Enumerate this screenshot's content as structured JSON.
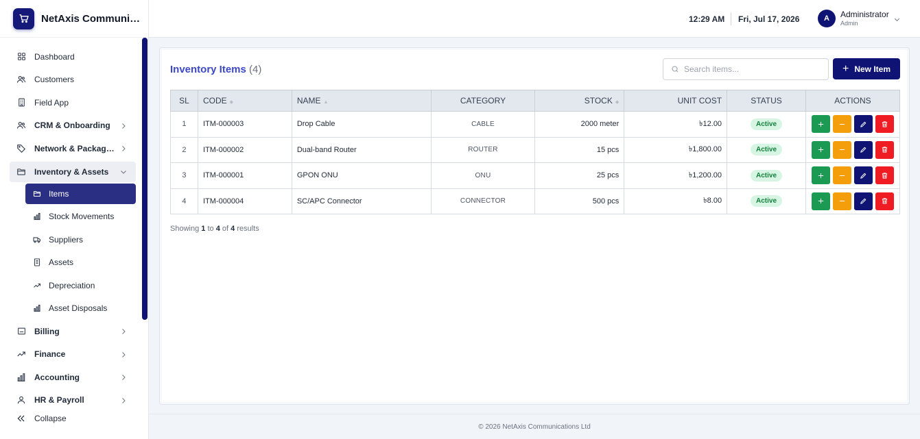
{
  "brand": {
    "name": "NetAxis Communi…"
  },
  "sidebar": {
    "items": [
      {
        "label": "Dashboard"
      },
      {
        "label": "Customers"
      },
      {
        "label": "Field App"
      },
      {
        "label": "CRM & Onboarding"
      },
      {
        "label": "Network & Packag…"
      },
      {
        "label": "Inventory & Assets"
      },
      {
        "label": "Billing"
      },
      {
        "label": "Finance"
      },
      {
        "label": "Accounting"
      },
      {
        "label": "HR & Payroll"
      }
    ],
    "inventory_sub": [
      {
        "label": "Items"
      },
      {
        "label": "Stock Movements"
      },
      {
        "label": "Suppliers"
      },
      {
        "label": "Assets"
      },
      {
        "label": "Depreciation"
      },
      {
        "label": "Asset Disposals"
      }
    ],
    "collapse_label": "Collapse"
  },
  "header": {
    "time": "12:29 AM",
    "date": "Fri, Jul 17, 2026",
    "avatar_initial": "A",
    "user_name": "Administrator",
    "user_role": "Admin"
  },
  "page": {
    "title": "Inventory Items",
    "count": "(4)",
    "search_placeholder": "Search items...",
    "new_button": "New Item"
  },
  "table": {
    "headers": {
      "sl": "SL",
      "code": "CODE",
      "name": "NAME",
      "category": "CATEGORY",
      "stock": "STOCK",
      "unit_cost": "UNIT COST",
      "status": "STATUS",
      "actions": "ACTIONS"
    },
    "rows": [
      {
        "sl": "1",
        "code": "ITM-000003",
        "name": "Drop Cable",
        "category": "CABLE",
        "stock": "2000 meter",
        "unit_cost": "৳12.00",
        "status": "Active"
      },
      {
        "sl": "2",
        "code": "ITM-000002",
        "name": "Dual-band Router",
        "category": "ROUTER",
        "stock": "15 pcs",
        "unit_cost": "৳1,800.00",
        "status": "Active"
      },
      {
        "sl": "3",
        "code": "ITM-000001",
        "name": "GPON ONU",
        "category": "ONU",
        "stock": "25 pcs",
        "unit_cost": "৳1,200.00",
        "status": "Active"
      },
      {
        "sl": "4",
        "code": "ITM-000004",
        "name": "SC/APC Connector",
        "category": "CONNECTOR",
        "stock": "500 pcs",
        "unit_cost": "৳8.00",
        "status": "Active"
      }
    ]
  },
  "pagination": {
    "prefix": "Showing",
    "from": "1",
    "to_word": "to",
    "to": "4",
    "of_word": "of",
    "total": "4",
    "suffix": "results"
  },
  "footer": {
    "text": "© 2026 NetAxis Communications Ltd"
  },
  "colors": {
    "brand": "#0f1474",
    "active_nav": "#2a2f83",
    "title": "#3b47c4",
    "add": "#1a9a52",
    "subtract": "#f59e0b",
    "delete": "#ef1c24",
    "status_active": "#15803d"
  }
}
